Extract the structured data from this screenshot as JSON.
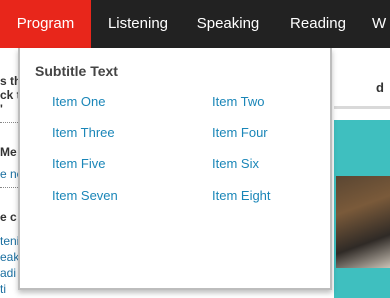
{
  "nav": {
    "items": [
      "Program",
      "Listening",
      "Speaking",
      "Reading",
      "W"
    ],
    "active_index": 0
  },
  "dropdown": {
    "title": "Subtitle Text",
    "items": [
      "Item One",
      "Item Two",
      "Item Three",
      "Item Four",
      "Item Five",
      "Item Six",
      "Item Seven",
      "Item Eight"
    ]
  },
  "background": {
    "left_lines": [
      "s the",
      "ck t",
      "'",
      "Me",
      "e ne",
      "e c",
      "teni",
      "eak",
      "adi",
      "ti"
    ],
    "right_fragment": "d"
  },
  "colors": {
    "nav_bg": "#222222",
    "nav_active": "#e8261b",
    "link": "#1a86b8",
    "accent_teal": "#3fbfbf"
  }
}
